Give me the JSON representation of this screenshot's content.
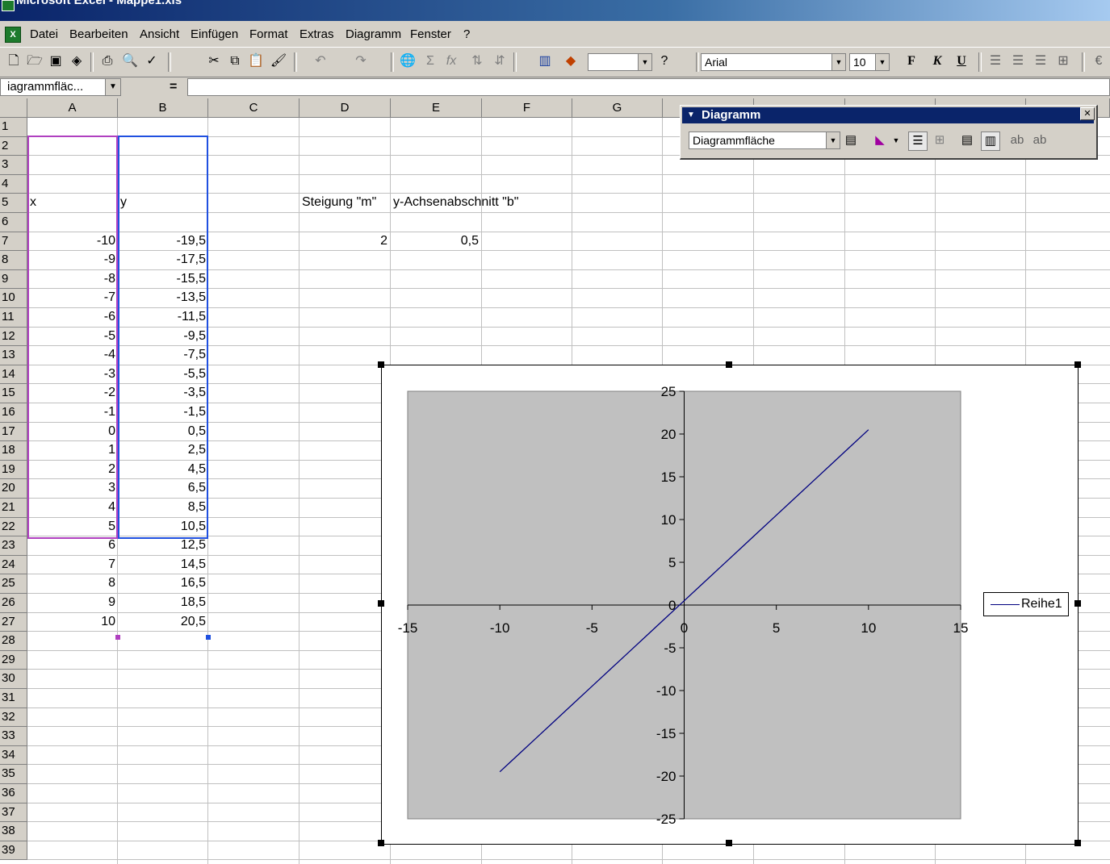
{
  "window": {
    "title": "Microsoft Excel - Mappe1.xls"
  },
  "menu": [
    "Datei",
    "Bearbeiten",
    "Ansicht",
    "Einfügen",
    "Format",
    "Extras",
    "Diagramm",
    "Fenster",
    "?"
  ],
  "toolbar": {
    "font_name": "Arial",
    "font_size": "10",
    "bold": "F",
    "italic": "K",
    "underline": "U",
    "icons": [
      "new-icon",
      "open-icon",
      "save-icon",
      "permission-icon",
      "print-icon",
      "print-preview-icon",
      "spelling-icon",
      "cut-icon",
      "copy-icon",
      "paste-icon",
      "format-painter-icon",
      "undo-icon",
      "redo-icon",
      "hyperlink-icon",
      "autosum-icon",
      "function-icon",
      "sort-ascending-icon",
      "sort-descending-icon",
      "chart-wizard-icon",
      "drawing-icon",
      "help-icon"
    ]
  },
  "formula_bar": {
    "name_box": "iagrammfläc...",
    "equals": "="
  },
  "sheet": {
    "columns": [
      "A",
      "B",
      "C",
      "D",
      "E",
      "F",
      "G"
    ],
    "rows": [
      "1",
      "2",
      "3",
      "4",
      "5",
      "6",
      "7",
      "8",
      "9",
      "10",
      "11",
      "12",
      "13",
      "14",
      "15",
      "16",
      "17",
      "18",
      "19",
      "20",
      "21",
      "22",
      "23",
      "24",
      "25",
      "26",
      "27",
      "28",
      "29",
      "30",
      "31",
      "32",
      "33",
      "34",
      "35",
      "36",
      "37",
      "38",
      "39"
    ],
    "header_x": "x",
    "header_y": "y",
    "label_slope": "Steigung \"m\"",
    "label_intercept": "y-Achsenabschnitt \"b\"",
    "slope": "2",
    "intercept": "0,5",
    "x_values": [
      "-10",
      "-9",
      "-8",
      "-7",
      "-6",
      "-5",
      "-4",
      "-3",
      "-2",
      "-1",
      "0",
      "1",
      "2",
      "3",
      "4",
      "5",
      "6",
      "7",
      "8",
      "9",
      "10"
    ],
    "y_values": [
      "-19,5",
      "-17,5",
      "-15,5",
      "-13,5",
      "-11,5",
      "-9,5",
      "-7,5",
      "-5,5",
      "-3,5",
      "-1,5",
      "0,5",
      "2,5",
      "4,5",
      "6,5",
      "8,5",
      "10,5",
      "12,5",
      "14,5",
      "16,5",
      "18,5",
      "20,5"
    ]
  },
  "diagram_toolbar": {
    "title": "Diagramm",
    "selected_object": "Diagrammfläche"
  },
  "chart_data": {
    "type": "scatter",
    "x": [
      -10,
      -9,
      -8,
      -7,
      -6,
      -5,
      -4,
      -3,
      -2,
      -1,
      0,
      1,
      2,
      3,
      4,
      5,
      6,
      7,
      8,
      9,
      10
    ],
    "series": [
      {
        "name": "Reihe1",
        "values": [
          -19.5,
          -17.5,
          -15.5,
          -13.5,
          -11.5,
          -9.5,
          -7.5,
          -5.5,
          -3.5,
          -1.5,
          0.5,
          2.5,
          4.5,
          6.5,
          8.5,
          10.5,
          12.5,
          14.5,
          16.5,
          18.5,
          20.5
        ]
      }
    ],
    "xlim": [
      -15,
      15
    ],
    "ylim": [
      -25,
      25
    ],
    "x_ticks": [
      "-15",
      "-10",
      "-5",
      "0",
      "5",
      "10",
      "15"
    ],
    "y_ticks": [
      "25",
      "20",
      "15",
      "10",
      "5",
      "0",
      "-5",
      "-10",
      "-15",
      "-20",
      "-25"
    ],
    "plot_background": "#c0c0c0",
    "line_color": "#000080",
    "legend_position": "right",
    "grid": false
  }
}
